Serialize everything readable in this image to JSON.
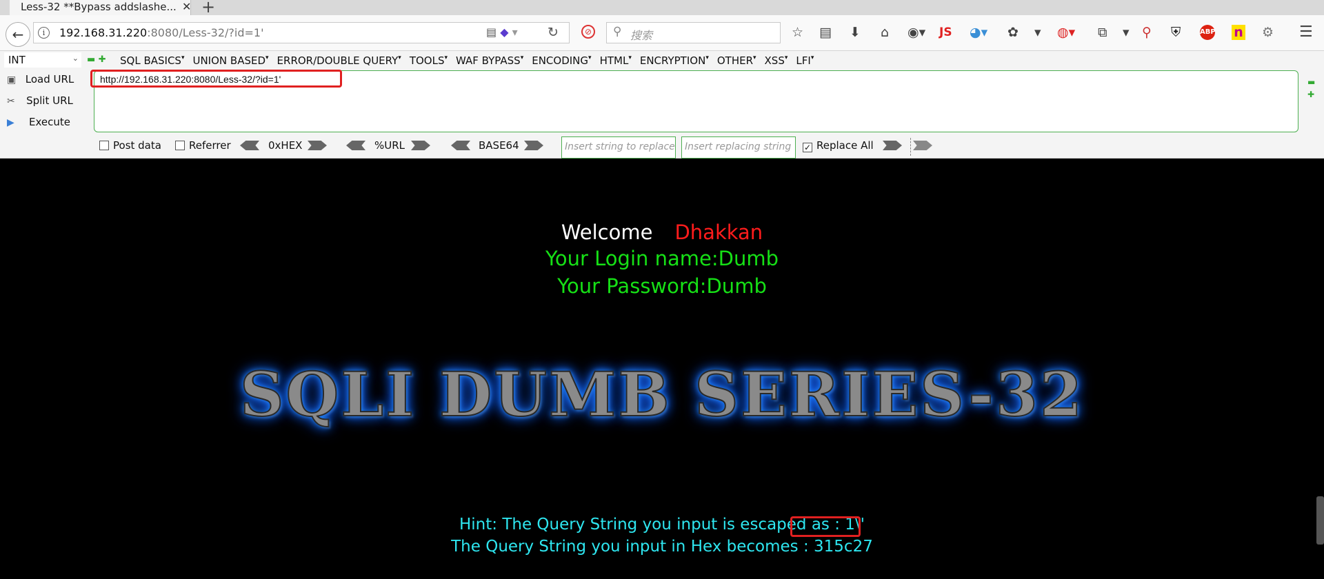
{
  "browser": {
    "tab_title": "Less-32 **Bypass addslashe...",
    "tab_close": "✕",
    "new_tab": "+",
    "address_host": "192.168.31.220",
    "address_rest": ":8080/Less-32/?id=1'",
    "search_placeholder": "搜索",
    "js_badge": "JS",
    "abp_badge": "ABP"
  },
  "hackbar": {
    "mode_select": "INT",
    "menus": [
      "SQL BASICS",
      "UNION BASED",
      "ERROR/DOUBLE QUERY",
      "TOOLS",
      "WAF BYPASS",
      "ENCODING",
      "HTML",
      "ENCRYPTION",
      "OTHER",
      "XSS",
      "LFI"
    ],
    "load_url": "Load URL",
    "split_url": "Split URL",
    "execute": "Execute",
    "url_value": "http://192.168.31.220:8080/Less-32/?id=1'",
    "post_data": "Post data",
    "referrer": "Referrer",
    "hex_label": "0xHEX",
    "url_enc_label": "%URL",
    "base64_label": "BASE64",
    "replace_placeholder": "Insert string to replace",
    "replacing_placeholder": "Insert replacing string",
    "replace_all": "Replace All",
    "replace_all_checked": true
  },
  "page": {
    "welcome": "Welcome",
    "welcome_name": "Dhakkan",
    "login_line": "Your Login name:Dumb",
    "password_line": "Your Password:Dumb",
    "banner": "SQLI DUMB SERIES-32",
    "hint_line": "Hint: The Query String you input is escaped as : 1\\'",
    "hex_line": "The Query String you input in Hex becomes : 315c27"
  },
  "colors": {
    "welcome_name": "#ff1c1c",
    "login_text": "#16e016",
    "hint_text": "#2ee6f0",
    "highlight_box": "#e02020",
    "banner_glow": "#1e8fff"
  }
}
